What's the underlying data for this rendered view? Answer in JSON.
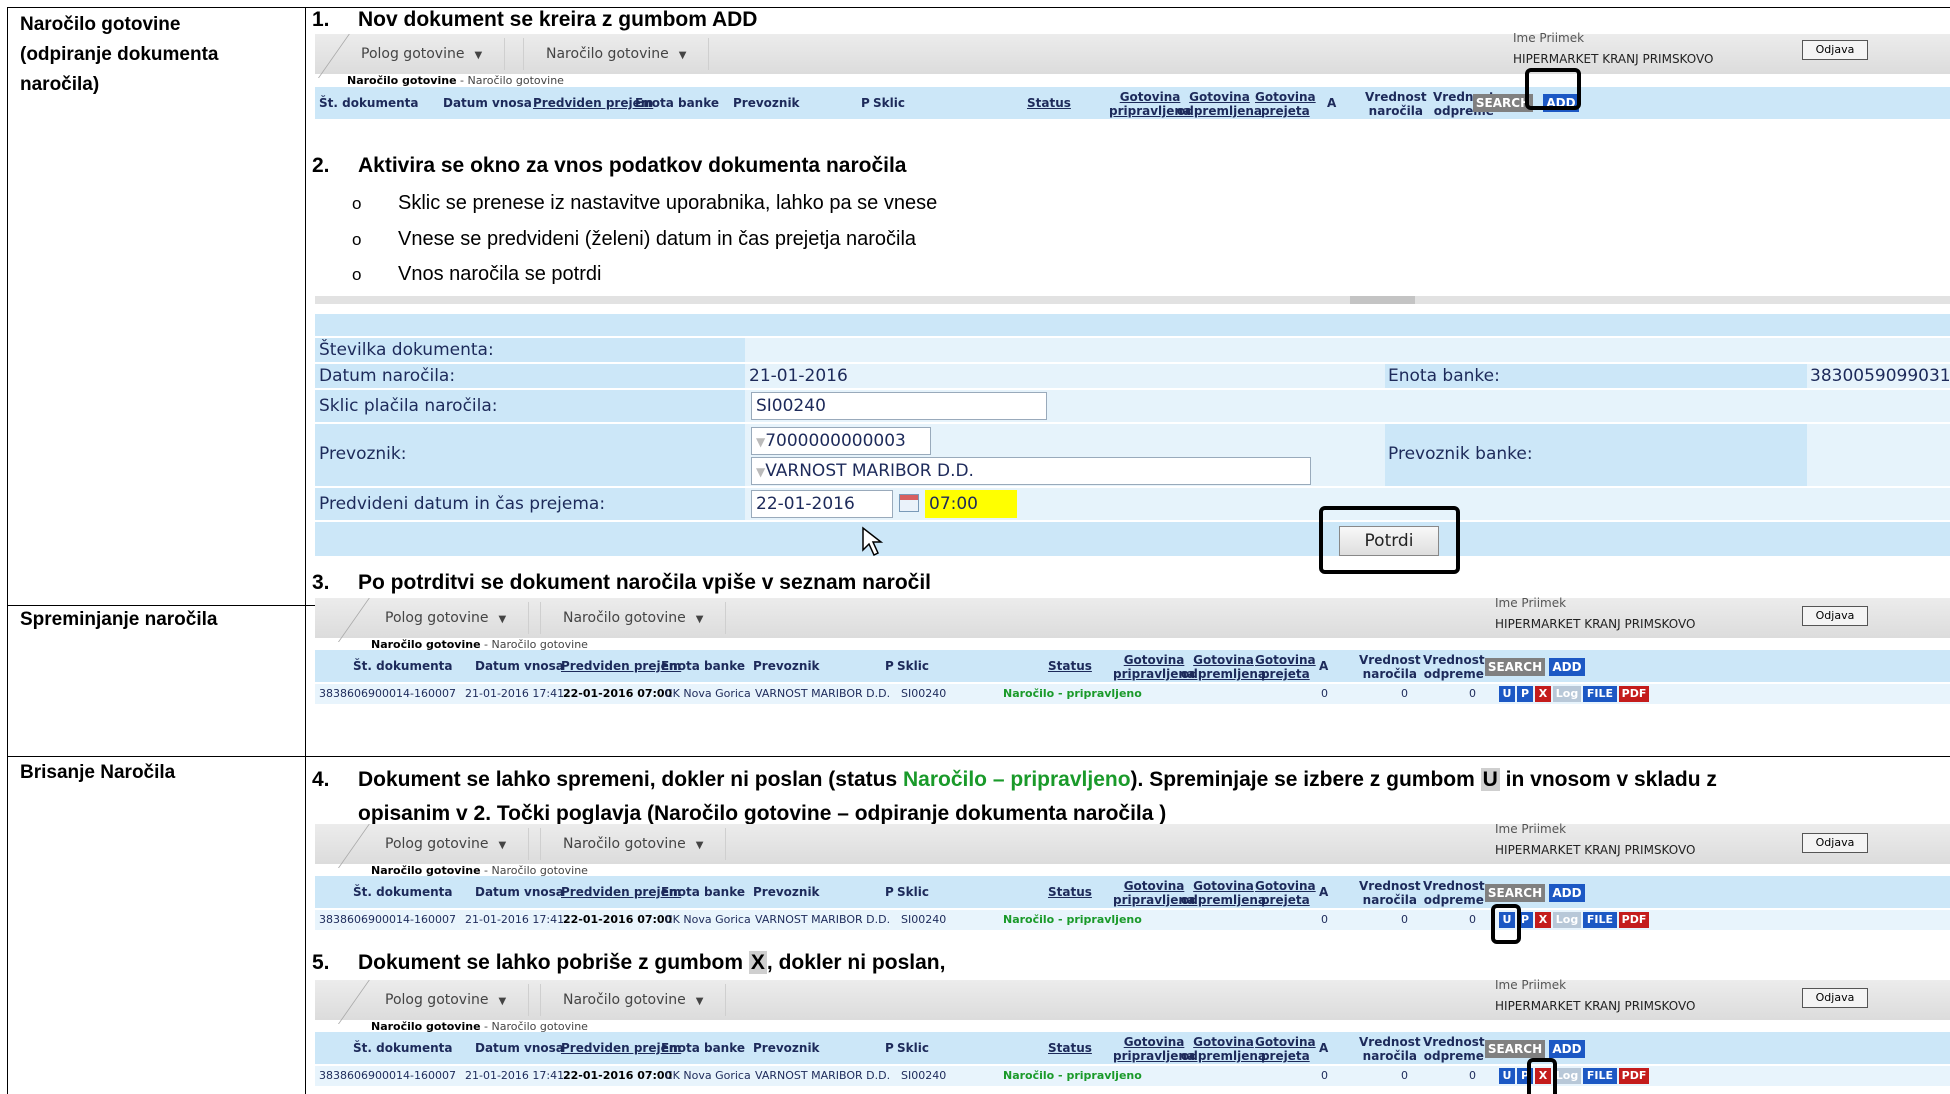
{
  "left": {
    "s1": [
      "Naročilo gotovine",
      "(odpiranje dokumenta",
      "naročila)"
    ],
    "s2": "Spreminjanje naročila",
    "s3": "Brisanje Naročila"
  },
  "steps": {
    "s1": {
      "num": "1.",
      "text": "Nov dokument se kreira z gumbom ADD"
    },
    "s2": {
      "num": "2.",
      "text": "Aktivira se okno za vnos podatkov dokumenta naročila"
    },
    "s3": {
      "num": "3.",
      "text": "Po potrditvi se dokument naročila vpiše v seznam naročil"
    },
    "s4": {
      "num": "4.",
      "a": "Dokument se lahko spremeni, dokler ni poslan  (status ",
      "status": "Naročilo – pripravljeno",
      "b": "). Spreminjaje se izbere z gumbom ",
      "key": "U",
      "c": " in vnosom v skladu z",
      "line2": "opisanim v 2. Točki poglavja (Naročilo gotovine – odpiranje dokumenta naročila )"
    },
    "s5": {
      "num": "5.",
      "a": "Dokument se lahko pobriše z gumbom ",
      "key": "X",
      "b": ", dokler ni poslan,"
    }
  },
  "bullets": [
    "Sklic se prenese iz nastavitve uporabnika, lahko pa se vnese",
    "Vnese se predvideni (želeni)  datum in čas prejetja naročila",
    "Vnos naročila se potrdi"
  ],
  "app": {
    "menu1": "Polog gotovine",
    "menu2": "Naročilo gotovine",
    "user_name": "Ime Priimek",
    "user_org": "HIPERMARKET KRANJ PRIMSKOVO",
    "logout": "Odjava",
    "crumb_bold": "Naročilo gotovine",
    "crumb_rest": " - Naročilo gotovine",
    "cols": {
      "st": "Št. dokumenta",
      "datum": "Datum vnosa",
      "predviden": "Predviden prejem",
      "enota": "Enota banke",
      "prevoznik": "Prevoznik",
      "p": "P",
      "sklic": "Sklic",
      "status": "Status",
      "gpripr1": "Gotovina",
      "gpripr2": "pripravljena",
      "godpr1": "Gotovina",
      "godpr2": "odpremljena",
      "gprej1": "Gotovina",
      "gprej2": "prejeta",
      "a": "A",
      "vnar1": "Vrednost",
      "vnar2": "naročila",
      "vodp1": "Vrednost",
      "vodp2": "odpreme"
    },
    "search": "SEARCH",
    "add": "ADD",
    "row": {
      "st": "3838606900014-160007",
      "datum": "21-01-2016 17:41",
      "predviden": "22-01-2016 07:00",
      "enota": "CK Nova Gorica",
      "prevoznik": "VARNOST MARIBOR D.D.",
      "sklic": "SI00240",
      "status": "Naročilo - pripravljeno",
      "a": "0",
      "vn": "0",
      "vo": "0"
    },
    "row_buttons": {
      "u": "U",
      "p": "P",
      "x": "X",
      "log": "Log",
      "file": "FILE",
      "pdf": "PDF"
    }
  },
  "form": {
    "st_label": "Številka dokumenta:",
    "datum_label": "Datum naročila:",
    "datum_value": "21-01-2016",
    "enota_label": "Enota banke:",
    "enota_value": "3830059099031",
    "sklic_label": "Sklic plačila naročila:",
    "sklic_value": "SI00240",
    "prev_label": "Prevoznik:",
    "prev_code": "7000000000003",
    "prev_name": "VARNOST MARIBOR D.D.",
    "prevb_label": "Prevoznik banke:",
    "pred_label": "Predvideni datum in čas prejema:",
    "pred_date": "22-01-2016",
    "pred_time": "07:00",
    "confirm": "Potrdi"
  },
  "colors": {
    "header_bg": "#cce7f8",
    "add_btn": "#1c58c4",
    "status_green": "#1a9a2a",
    "highlight_time": "#ffff00"
  }
}
